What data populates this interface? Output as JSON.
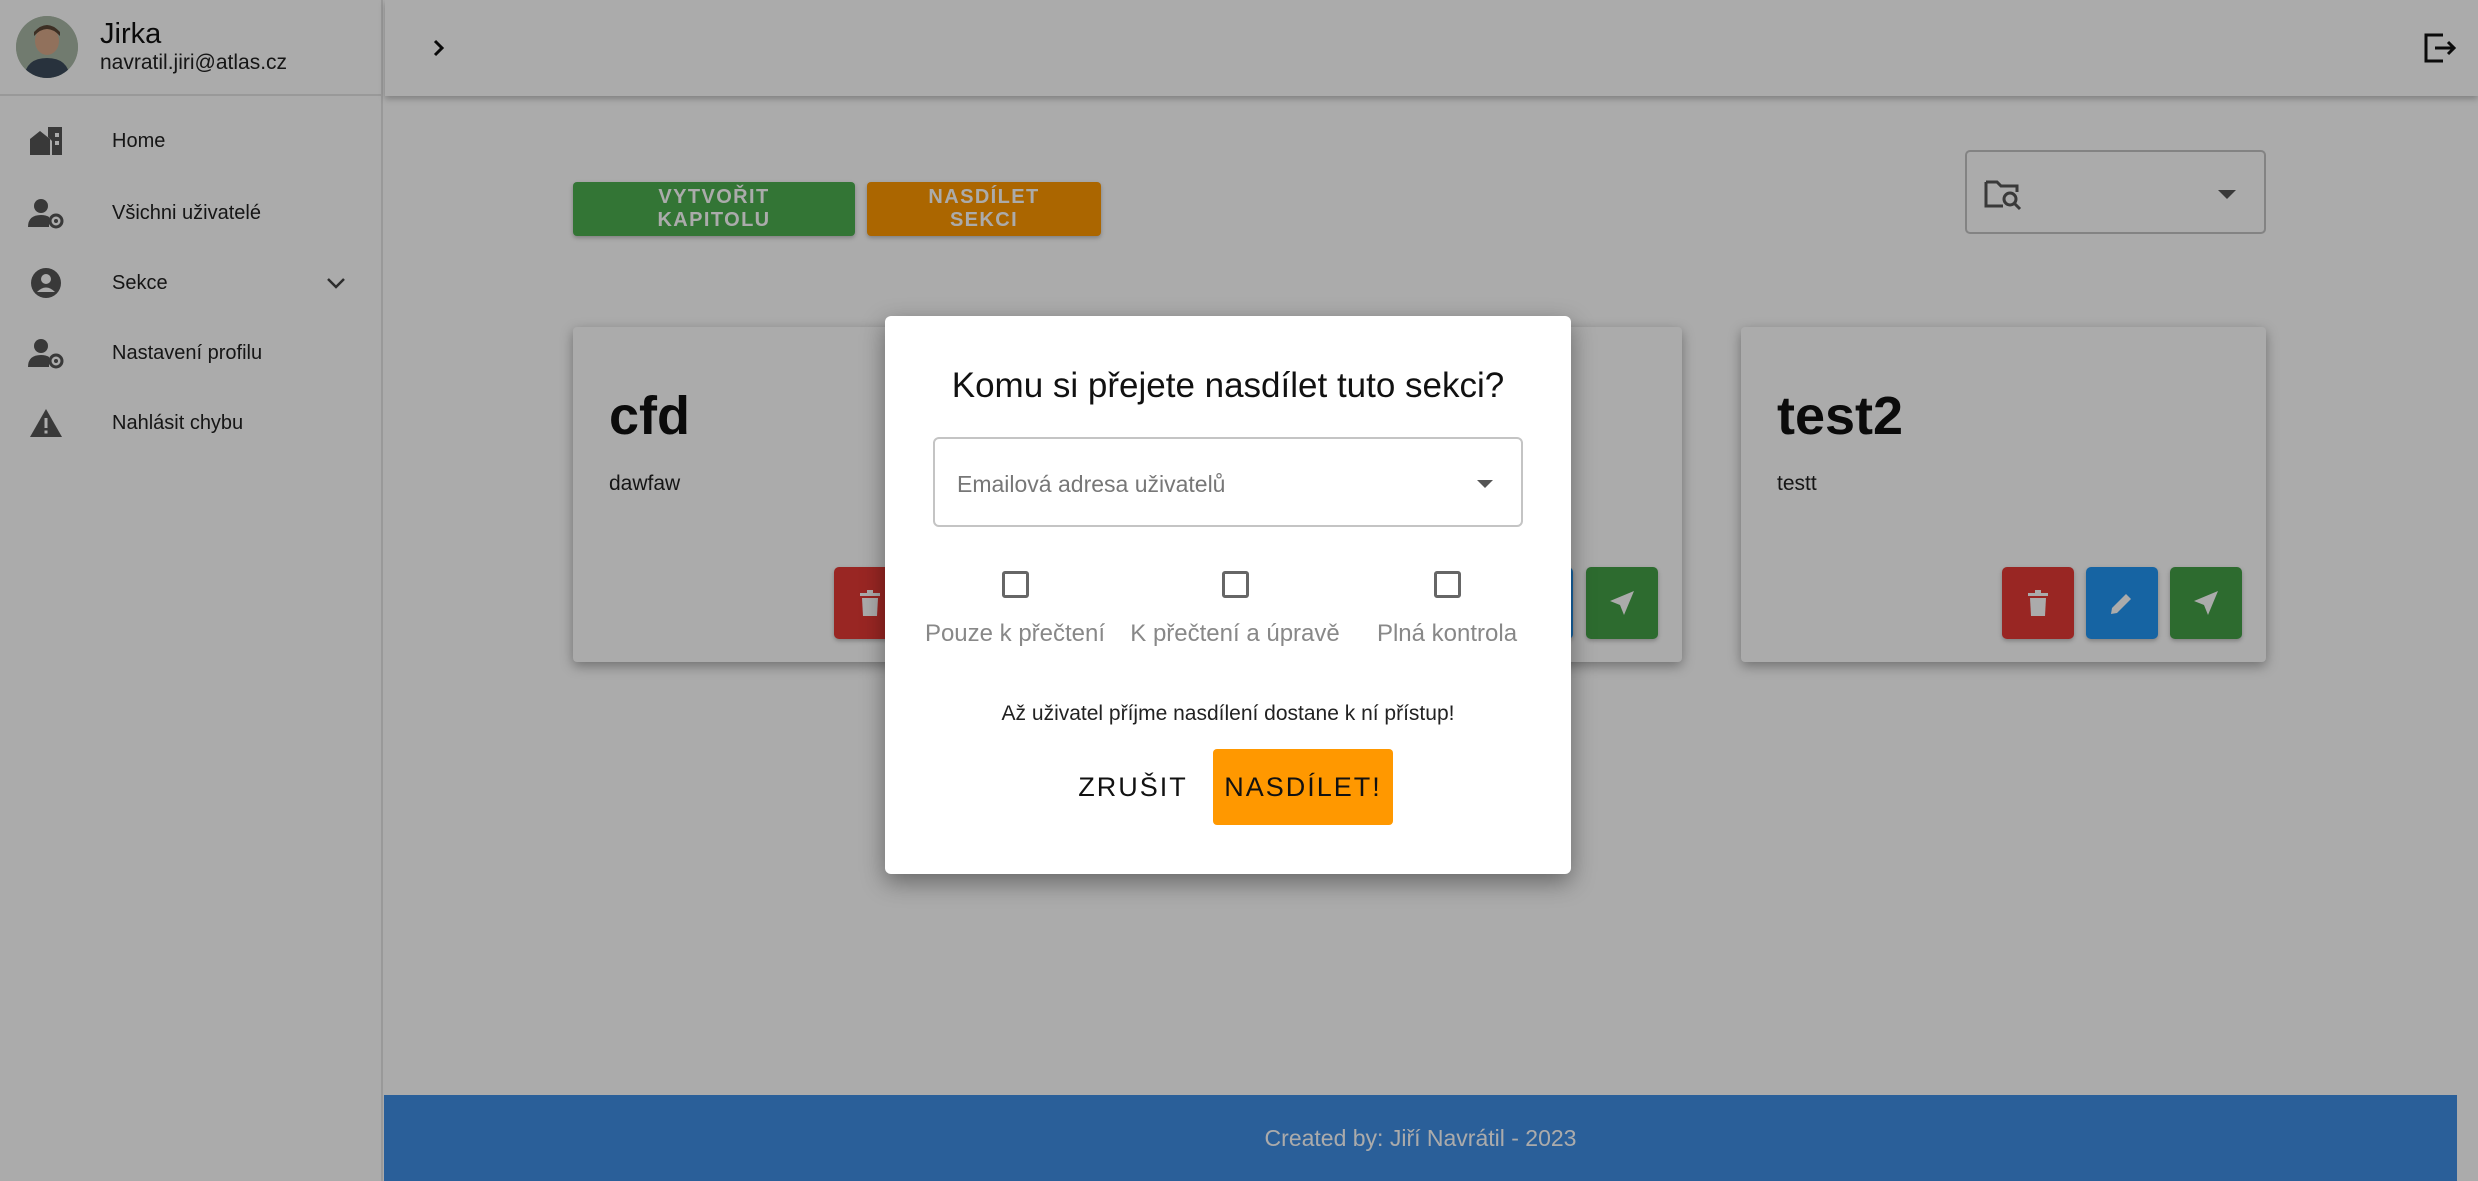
{
  "user": {
    "name": "Jirka",
    "email": "navratil.jiri@atlas.cz",
    "avatar_icon": "user-avatar"
  },
  "sidebar": {
    "items": [
      {
        "label": "Home",
        "icon": "home-icon"
      },
      {
        "label": "Všichni uživatelé",
        "icon": "user-settings-icon"
      },
      {
        "label": "Sekce",
        "icon": "account-circle-icon",
        "expandable": true
      },
      {
        "label": "Nastavení profilu",
        "icon": "user-settings-icon"
      },
      {
        "label": "Nahlásit chybu",
        "icon": "warning-icon"
      }
    ]
  },
  "toolbar": {
    "create_chapter_label": "VYTVOŘIT KAPITOLU",
    "share_section_label": "NASDÍLET SEKCI",
    "folder_select_value": ""
  },
  "cards": [
    {
      "title": "cfd",
      "description": "dawfaw"
    },
    {
      "title": "test2",
      "description": "testt"
    }
  ],
  "dialog": {
    "title": "Komu si přejete nasdílet tuto sekci?",
    "email_placeholder": "Emailová adresa uživatelů",
    "permissions": [
      {
        "label": "Pouze k přečtení",
        "checked": false
      },
      {
        "label": "K přečtení a úpravě",
        "checked": false
      },
      {
        "label": "Plná kontrola",
        "checked": false
      }
    ],
    "note": "Až uživatel příjme nasdílení dostane k ní přístup!",
    "cancel_label": "ZRUŠIT",
    "confirm_label": "NASDÍLET!"
  },
  "footer": {
    "text": "Created by: Jiří Navrátil - 2023"
  },
  "colors": {
    "primary_green": "#4caf50",
    "accent_orange": "#ff9800",
    "danger_red": "#e53935",
    "edit_blue": "#2196f3",
    "footer_blue": "#3f8ee4"
  }
}
